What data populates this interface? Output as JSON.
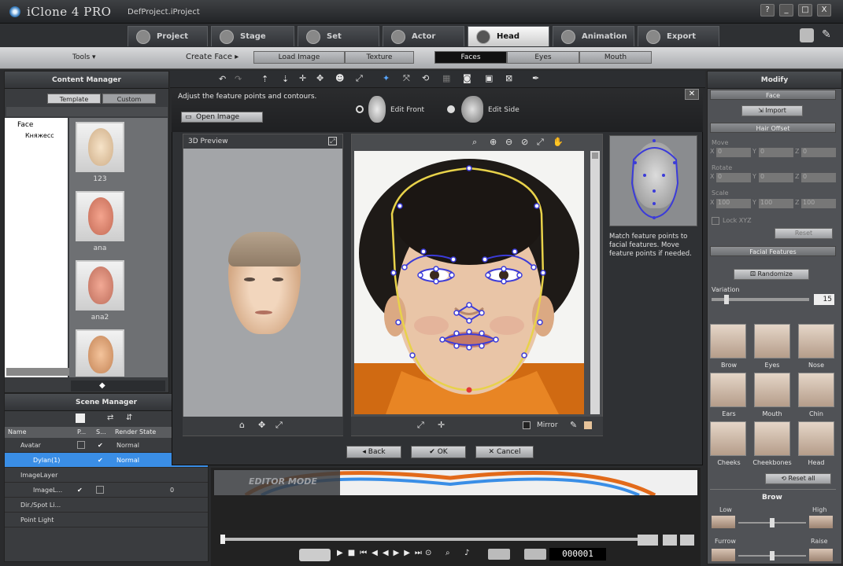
{
  "window": {
    "app_title": "iClone 4 PRO",
    "project": "DefProject.iProject",
    "buttons": [
      "?",
      "_",
      "□",
      "X"
    ]
  },
  "main_tabs": [
    {
      "label": "Project",
      "icon": "project-icon"
    },
    {
      "label": "Stage",
      "icon": "stage-icon"
    },
    {
      "label": "Set",
      "icon": "set-icon"
    },
    {
      "label": "Actor",
      "icon": "actor-icon"
    },
    {
      "label": "Head",
      "icon": "head-icon",
      "active": true
    },
    {
      "label": "Animation",
      "icon": "animation-icon"
    },
    {
      "label": "Export",
      "icon": "export-icon"
    }
  ],
  "subtoolbar": {
    "tools": "Tools ▾",
    "create_face": "Create Face ▸",
    "load_image": "Load Image",
    "texture": "Texture",
    "faces": "Faces",
    "eyes": "Eyes",
    "mouth": "Mouth"
  },
  "content_manager": {
    "title": "Content Manager",
    "tab_template": "Template",
    "tab_custom": "Custom",
    "tree": [
      "Face",
      "Княжесс"
    ],
    "thumbs": [
      "123",
      "ana",
      "ana2",
      ""
    ]
  },
  "scene_manager": {
    "title": "Scene Manager",
    "columns": [
      "Name",
      "P...",
      "S...",
      "Render State"
    ],
    "rows": [
      {
        "name": "Avatar",
        "state": "Normal",
        "selected": false
      },
      {
        "name": "Dylan(1)",
        "state": "Normal",
        "selected": true
      },
      {
        "name": "ImageLayer",
        "state": "",
        "selected": false
      },
      {
        "name": "ImageL...",
        "state": "0",
        "selected": false
      },
      {
        "name": "Dir./Spot Li...",
        "state": "",
        "selected": false
      },
      {
        "name": "Point Light",
        "state": "",
        "selected": false
      }
    ]
  },
  "dialog": {
    "instruction": "Adjust the feature points and contours.",
    "open_image": "Open Image",
    "edit_front": "Edit Front",
    "edit_side": "Edit Side",
    "preview_title": "3D Preview",
    "help_text": "Match feature points to facial features. Move feature points if needed.",
    "mirror": "Mirror",
    "back": "Back",
    "ok": "OK",
    "cancel": "Cancel"
  },
  "modify": {
    "title": "Modify",
    "face_section": "Face",
    "import": "Import",
    "hair_offset": "Hair Offset",
    "move": "Move",
    "rotate": "Rotate",
    "scale": "Scale",
    "move_vals": [
      "0",
      "0",
      "0"
    ],
    "rotate_vals": [
      "0",
      "0",
      "0"
    ],
    "scale_vals": [
      "100",
      "100",
      "100"
    ],
    "lock_xyz": "Lock XYZ",
    "reset": "Reset",
    "facial_features": "Facial Features",
    "randomize": "Randomize",
    "variation": "Variation",
    "variation_value": "15",
    "features": [
      "Brow",
      "Eyes",
      "Nose",
      "Ears",
      "Mouth",
      "Chin",
      "Cheeks",
      "Cheekbones",
      "Head"
    ],
    "reset_all": "Reset all",
    "brow_section": "Brow",
    "low": "Low",
    "high": "High",
    "furrow": "Furrow",
    "raise": "Raise"
  },
  "timeline": {
    "watermark": "EDITOR MODE",
    "counter": "000001"
  },
  "colors": {
    "accent": "#3a8ee6",
    "contour": "#e8d24a",
    "points": "#3b3bd9"
  }
}
